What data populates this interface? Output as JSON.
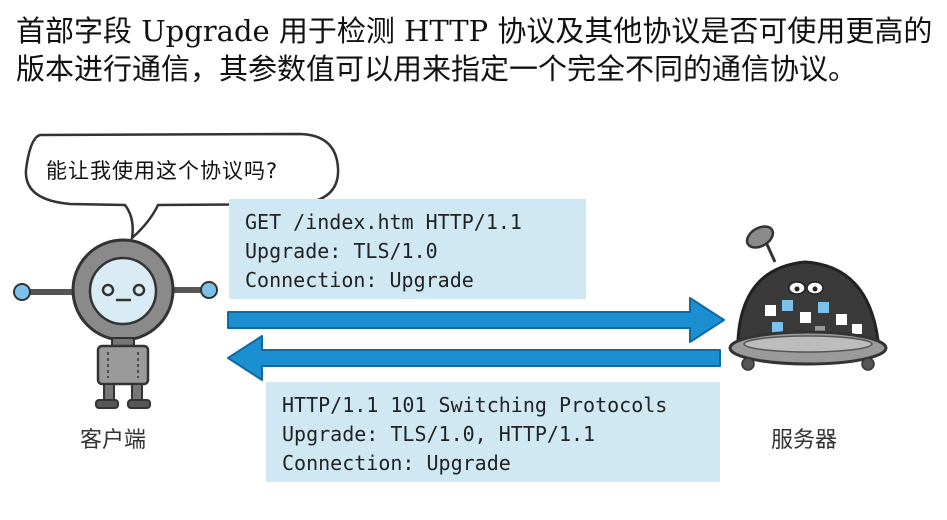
{
  "intro": {
    "text": "首部字段 Upgrade 用于检测 HTTP 协议及其他协议是否可使用更高的版本进行通信，其参数值可以用来指定一个完全不同的通信协议。"
  },
  "bubble": {
    "text": "能让我使用这个协议吗?"
  },
  "request": {
    "line1": "GET /index.htm HTTP/1.1",
    "line2": "Upgrade: TLS/1.0",
    "line3": "Connection: Upgrade"
  },
  "response": {
    "line1": "HTTP/1.1 101 Switching Protocols",
    "line2": "Upgrade: TLS/1.0, HTTP/1.1",
    "line3": "Connection: Upgrade"
  },
  "labels": {
    "client": "客户端",
    "server": "服务器"
  },
  "colors": {
    "arrow": "#1b8fd0",
    "arrow_dark": "#0f6aa3",
    "box": "#cfe8f4",
    "robot_body": "#8a8a8a",
    "robot_face": "#6f6f6f",
    "server_dome": "#3a3a3a",
    "accent_blue": "#7cc2e8"
  }
}
